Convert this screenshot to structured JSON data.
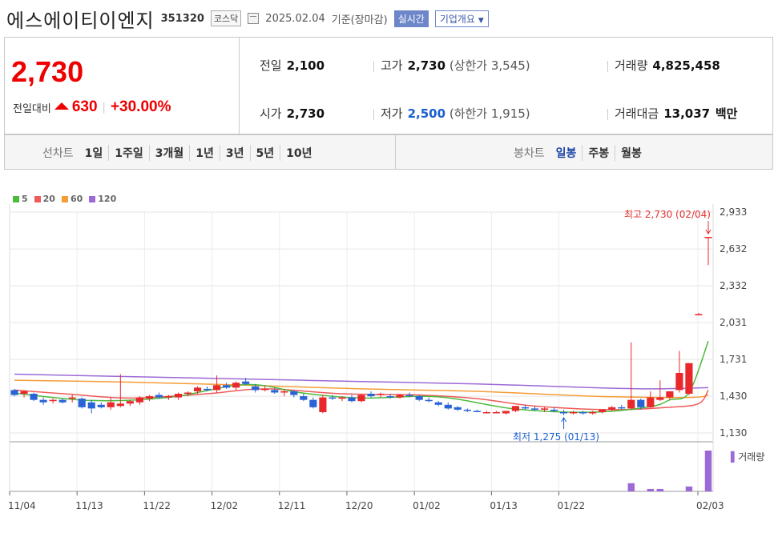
{
  "header": {
    "company": "에스에이티이엔지",
    "code": "351320",
    "market": "코스닥",
    "date": "2025.02.04",
    "basis": "기준(장마감)",
    "realtime_btn": "실시간",
    "corp_btn": "기업개요"
  },
  "quote": {
    "price": "2,730",
    "change_label": "전일대비",
    "change": "630",
    "change_pct": "+30.00%",
    "prev_close_label": "전일",
    "prev_close": "2,100",
    "open_label": "시가",
    "open": "2,730",
    "high_label": "고가",
    "high": "2,730",
    "upper_limit_label": "(상한가 3,545)",
    "low_label": "저가",
    "low": "2,500",
    "lower_limit_label": "(하한가 1,915)",
    "volume_label": "거래량",
    "volume": "4,825,458",
    "value_label": "거래대금",
    "value": "13,037",
    "value_unit": "백만"
  },
  "toolbar": {
    "line_label": "선차트",
    "line_items": [
      "1일",
      "1주일",
      "3개월",
      "1년",
      "3년",
      "5년",
      "10년"
    ],
    "candle_label": "봉차트",
    "candle_items": [
      "일봉",
      "주봉",
      "월봉"
    ],
    "candle_active": 0
  },
  "colors": {
    "up": "#e8282b",
    "down": "#2a63d6",
    "ma5": "#4cbb3c",
    "ma20": "#ef5a5a",
    "ma60": "#f59c36",
    "ma120": "#9b6ad6",
    "volume": "#9b6ad6"
  },
  "chart_data": {
    "type": "candlestick",
    "legend": [
      "5",
      "20",
      "60",
      "120"
    ],
    "ylim": [
      1130,
      2933
    ],
    "yticks": [
      "2,933",
      "2,632",
      "2,332",
      "2,031",
      "1,731",
      "1,430",
      "1,130"
    ],
    "xlabels": [
      "11/04",
      "11/13",
      "11/22",
      "12/02",
      "12/11",
      "12/20",
      "01/02",
      "01/13",
      "01/22",
      "02/03"
    ],
    "max_annotation": "최고 2,730 (02/04)",
    "min_annotation": "최저 1,275 (01/13)",
    "volume_label": "거래량",
    "candles": [
      [
        1480,
        1490,
        1430,
        1440
      ],
      [
        1450,
        1480,
        1420,
        1470
      ],
      [
        1450,
        1460,
        1390,
        1400
      ],
      [
        1400,
        1420,
        1360,
        1380
      ],
      [
        1390,
        1410,
        1370,
        1400
      ],
      [
        1400,
        1410,
        1370,
        1380
      ],
      [
        1410,
        1440,
        1380,
        1420
      ],
      [
        1410,
        1420,
        1330,
        1340
      ],
      [
        1380,
        1400,
        1290,
        1330
      ],
      [
        1360,
        1380,
        1330,
        1340
      ],
      [
        1340,
        1420,
        1320,
        1380
      ],
      [
        1350,
        1610,
        1340,
        1370
      ],
      [
        1370,
        1400,
        1350,
        1390
      ],
      [
        1380,
        1430,
        1360,
        1420
      ],
      [
        1410,
        1440,
        1390,
        1430
      ],
      [
        1440,
        1460,
        1410,
        1420
      ],
      [
        1420,
        1440,
        1400,
        1430
      ],
      [
        1420,
        1460,
        1400,
        1450
      ],
      [
        1450,
        1470,
        1430,
        1460
      ],
      [
        1470,
        1510,
        1450,
        1500
      ],
      [
        1490,
        1510,
        1470,
        1480
      ],
      [
        1480,
        1600,
        1460,
        1520
      ],
      [
        1520,
        1540,
        1490,
        1500
      ],
      [
        1500,
        1550,
        1480,
        1540
      ],
      [
        1550,
        1580,
        1520,
        1530
      ],
      [
        1510,
        1530,
        1460,
        1480
      ],
      [
        1490,
        1520,
        1470,
        1490
      ],
      [
        1480,
        1500,
        1450,
        1460
      ],
      [
        1460,
        1490,
        1430,
        1470
      ],
      [
        1470,
        1480,
        1420,
        1440
      ],
      [
        1430,
        1450,
        1390,
        1400
      ],
      [
        1400,
        1420,
        1330,
        1340
      ],
      [
        1300,
        1440,
        1290,
        1420
      ],
      [
        1420,
        1440,
        1400,
        1410
      ],
      [
        1410,
        1430,
        1390,
        1420
      ],
      [
        1420,
        1440,
        1380,
        1390
      ],
      [
        1390,
        1450,
        1380,
        1440
      ],
      [
        1450,
        1470,
        1420,
        1430
      ],
      [
        1440,
        1460,
        1420,
        1450
      ],
      [
        1430,
        1450,
        1410,
        1420
      ],
      [
        1420,
        1450,
        1410,
        1440
      ],
      [
        1440,
        1460,
        1420,
        1430
      ],
      [
        1430,
        1440,
        1390,
        1400
      ],
      [
        1400,
        1420,
        1380,
        1390
      ],
      [
        1380,
        1390,
        1350,
        1360
      ],
      [
        1360,
        1380,
        1320,
        1330
      ],
      [
        1340,
        1350,
        1310,
        1320
      ],
      [
        1320,
        1330,
        1300,
        1310
      ],
      [
        1310,
        1320,
        1300,
        1300
      ],
      [
        1300,
        1310,
        1290,
        1300
      ],
      [
        1300,
        1310,
        1290,
        1300
      ],
      [
        1290,
        1310,
        1280,
        1310
      ],
      [
        1310,
        1350,
        1300,
        1350
      ],
      [
        1340,
        1360,
        1320,
        1330
      ],
      [
        1330,
        1350,
        1310,
        1320
      ],
      [
        1320,
        1340,
        1300,
        1330
      ],
      [
        1320,
        1340,
        1300,
        1310
      ],
      [
        1300,
        1320,
        1275,
        1290
      ],
      [
        1290,
        1310,
        1280,
        1300
      ],
      [
        1300,
        1310,
        1280,
        1290
      ],
      [
        1290,
        1310,
        1280,
        1300
      ],
      [
        1300,
        1320,
        1290,
        1320
      ],
      [
        1320,
        1350,
        1310,
        1340
      ],
      [
        1340,
        1360,
        1320,
        1330
      ],
      [
        1330,
        1870,
        1320,
        1400
      ],
      [
        1400,
        1410,
        1320,
        1340
      ],
      [
        1340,
        1470,
        1330,
        1420
      ],
      [
        1400,
        1560,
        1390,
        1420
      ],
      [
        1420,
        1470,
        1400,
        1470
      ],
      [
        1480,
        1800,
        1460,
        1620
      ],
      [
        1450,
        1700,
        1440,
        1700
      ],
      [
        2100,
        2110,
        2090,
        2100
      ],
      [
        2730,
        2730,
        2500,
        2730
      ]
    ],
    "ma": {
      "5": [
        [
          0,
          1455
        ],
        [
          8,
          1395
        ],
        [
          16,
          1420
        ],
        [
          24,
          1525
        ],
        [
          30,
          1455
        ],
        [
          36,
          1415
        ],
        [
          44,
          1425
        ],
        [
          52,
          1325
        ],
        [
          60,
          1300
        ],
        [
          66,
          1345
        ],
        [
          68,
          1400
        ],
        [
          70,
          1460
        ],
        [
          72,
          1880
        ]
      ],
      "20": [
        [
          0,
          1480
        ],
        [
          6,
          1445
        ],
        [
          12,
          1415
        ],
        [
          20,
          1450
        ],
        [
          26,
          1490
        ],
        [
          34,
          1450
        ],
        [
          42,
          1440
        ],
        [
          48,
          1410
        ],
        [
          54,
          1350
        ],
        [
          62,
          1320
        ],
        [
          68,
          1340
        ],
        [
          71,
          1370
        ],
        [
          72,
          1480
        ]
      ],
      "60": [
        [
          0,
          1560
        ],
        [
          12,
          1545
        ],
        [
          24,
          1520
        ],
        [
          36,
          1490
        ],
        [
          48,
          1470
        ],
        [
          60,
          1430
        ],
        [
          70,
          1420
        ],
        [
          72,
          1440
        ]
      ],
      "120": [
        [
          0,
          1610
        ],
        [
          12,
          1590
        ],
        [
          24,
          1570
        ],
        [
          36,
          1550
        ],
        [
          48,
          1530
        ],
        [
          60,
          1500
        ],
        [
          66,
          1490
        ],
        [
          72,
          1500
        ]
      ]
    },
    "volume": [
      [
        64,
        0.2
      ],
      [
        66,
        0.06
      ],
      [
        67,
        0.06
      ],
      [
        70,
        0.12
      ],
      [
        72,
        1.0
      ]
    ]
  }
}
